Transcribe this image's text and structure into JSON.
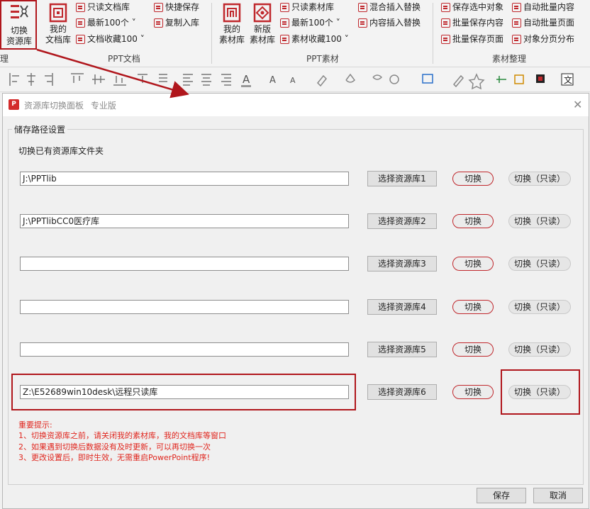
{
  "ribbon": {
    "switch_btn": {
      "line1": "切换",
      "line2": "资源库"
    },
    "my_doc_btn": {
      "line1": "我的",
      "line2": "文档库"
    },
    "doc_items": [
      "只读文档库",
      "最新100个 ˅",
      "文档收藏100 ˅"
    ],
    "doc_items2": [
      "快捷保存",
      "复制入库"
    ],
    "group_ppt_doc": "PPT文档",
    "my_mat_btn": {
      "line1": "我的",
      "line2": "素材库"
    },
    "new_mat_btn": {
      "line1": "新版",
      "line2": "素材库"
    },
    "mat_items": [
      "只读素材库",
      "最新100个 ˅",
      "素材收藏100 ˅"
    ],
    "mat_items2": [
      "混合插入替换",
      "内容插入替换"
    ],
    "group_ppt_mat": "PPT素材",
    "org_items1": [
      "保存选中对象",
      "批量保存内容",
      "批量保存页面"
    ],
    "org_items2": [
      "自动批量内容",
      "自动批量页面",
      "对象分页分布"
    ],
    "group_org": "素材整理",
    "left_edge": "理"
  },
  "dialog": {
    "title": "资源库切换面板",
    "edition": "专业版",
    "close": "✕",
    "legend": "储存路径设置",
    "subtitle": "切换已有资源库文件夹",
    "rows": [
      {
        "path": "J:\\PPTlib",
        "select": "选择资源库1",
        "switch": "切换",
        "readonly": "切换（只读）"
      },
      {
        "path": "J:\\PPTlibCC0医疗库",
        "select": "选择资源库2",
        "switch": "切换",
        "readonly": "切换（只读）"
      },
      {
        "path": "",
        "select": "选择资源库3",
        "switch": "切换",
        "readonly": "切换（只读）"
      },
      {
        "path": "",
        "select": "选择资源库4",
        "switch": "切换",
        "readonly": "切换（只读）"
      },
      {
        "path": "",
        "select": "选择资源库5",
        "switch": "切换",
        "readonly": "切换（只读）"
      },
      {
        "path": "Z:\\E52689win10desk\\远程只读库",
        "select": "选择资源库6",
        "switch": "切换",
        "readonly": "切换（只读）"
      }
    ],
    "tips": [
      "重要提示:",
      "1、切换资源库之前，请关闭我的素材库，我的文档库等窗口",
      "2、如果遇到切换后数据没有及时更新，可以再切换一次",
      "3、更改设置后，即时生效，无需重启PowerPoint程序!"
    ],
    "save": "保存",
    "cancel": "取消"
  },
  "colors": {
    "accent": "#c0282d",
    "tip_red": "#e0261e",
    "highlight": "#b0161c"
  }
}
